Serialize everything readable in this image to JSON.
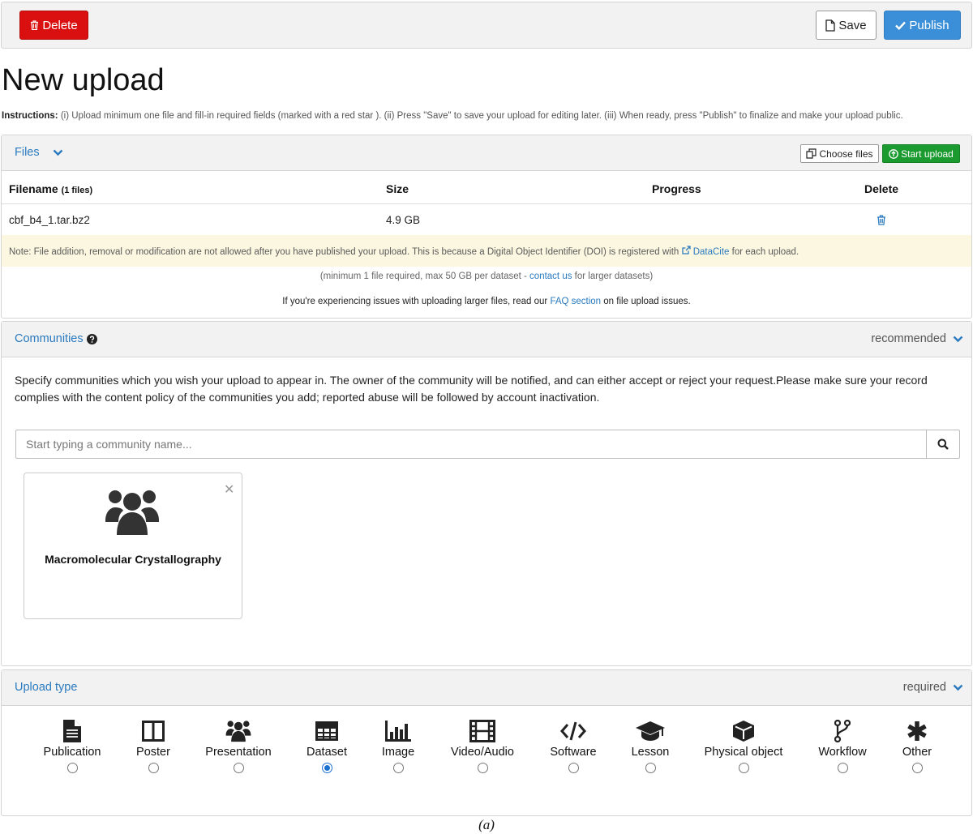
{
  "toolbar": {
    "delete_label": "Delete",
    "save_label": "Save",
    "publish_label": "Publish"
  },
  "page": {
    "title": "New upload",
    "instructions_label": "Instructions:",
    "instructions_text": "(i) Upload minimum one file and fill-in required fields (marked with a red star ). (ii) Press \"Save\" to save your upload for editing later. (iii) When ready, press \"Publish\" to finalize and make your upload public."
  },
  "files": {
    "title": "Files",
    "choose_label": "Choose files",
    "start_label": "Start upload",
    "columns": {
      "filename": "Filename",
      "filecount": "(1 files)",
      "size": "Size",
      "progress": "Progress",
      "delete": "Delete"
    },
    "rows": [
      {
        "name": "cbf_b4_1.tar.bz2",
        "size": "4.9 GB"
      }
    ],
    "note_before": "Note: File addition, removal or modification are not allowed after you have published your upload. This is because a Digital Object Identifier (DOI) is registered with",
    "note_link": "DataCite",
    "note_after": "for each upload.",
    "min_before": "(minimum 1 file required, max 50 GB per dataset -",
    "min_link": "contact us",
    "min_after": "for larger datasets)",
    "faq_before": "If you're experiencing issues with uploading larger files, read our",
    "faq_link": "FAQ section",
    "faq_after": "on file upload issues."
  },
  "communities": {
    "title": "Communities",
    "status": "recommended",
    "description": "Specify communities which you wish your upload to appear in. The owner of the community will be notified, and can either accept or reject your request.Please make sure your record complies with the content policy of the communities you add; reported abuse will be followed by account inactivation.",
    "search_placeholder": "Start typing a community name...",
    "selected": [
      {
        "name": "Macromolecular Crystallography"
      }
    ]
  },
  "upload_type": {
    "title": "Upload type",
    "status": "required",
    "options": [
      {
        "label": "Publication",
        "icon": "file-text-icon",
        "checked": false
      },
      {
        "label": "Poster",
        "icon": "columns-icon",
        "checked": false
      },
      {
        "label": "Presentation",
        "icon": "group-icon",
        "checked": false
      },
      {
        "label": "Dataset",
        "icon": "table-icon",
        "checked": true
      },
      {
        "label": "Image",
        "icon": "bar-chart-icon",
        "checked": false
      },
      {
        "label": "Video/Audio",
        "icon": "film-icon",
        "checked": false
      },
      {
        "label": "Software",
        "icon": "code-icon",
        "checked": false
      },
      {
        "label": "Lesson",
        "icon": "graduation-cap-icon",
        "checked": false
      },
      {
        "label": "Physical object",
        "icon": "cube-icon",
        "checked": false
      },
      {
        "label": "Workflow",
        "icon": "code-fork-icon",
        "checked": false
      },
      {
        "label": "Other",
        "icon": "asterisk-icon",
        "checked": false
      }
    ]
  },
  "caption": "(a)",
  "colors": {
    "danger": "#d9100f",
    "primary": "#3a8fd8",
    "success": "#1a9a2f",
    "link": "#2a7abf",
    "note_bg": "#fcf7e0"
  }
}
